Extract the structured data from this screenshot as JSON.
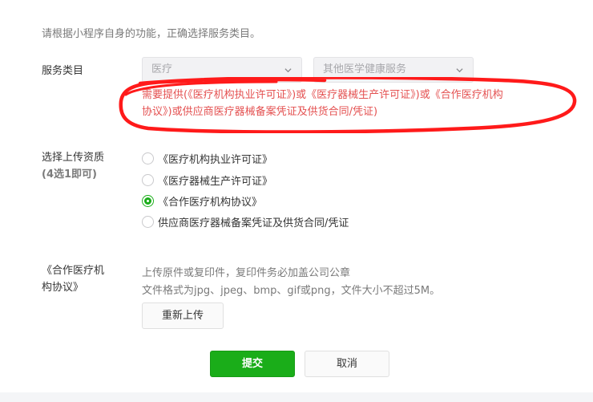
{
  "intro_text": "请根据小程序自身的功能，正确选择服务类目。",
  "category": {
    "label": "服务类目",
    "primary_value": "医疗",
    "secondary_value": "其他医学健康服务",
    "notice_line1": "需要提供(《医疗机构执业许可证》)或《医疗器械生产许可证》)或《合作医疗机构",
    "notice_line2": "协议》)或供应商医疗器械备案凭证及供货合同/凭证)"
  },
  "qualification": {
    "label": "选择上传资质",
    "sub_label": "(4选1即可)",
    "options": [
      {
        "label": "《医疗机构执业许可证》",
        "checked": false
      },
      {
        "label": "《医疗器械生产许可证》",
        "checked": false
      },
      {
        "label": "《合作医疗机构协议》",
        "checked": true
      },
      {
        "label": "供应商医疗器械备案凭证及供货合同/凭证",
        "checked": false
      }
    ]
  },
  "upload": {
    "label_line1": "《合作医疗机",
    "label_line2": "构协议》",
    "hint1": "上传原件或复印件，复印件务必加盖公司公章",
    "hint2": "文件格式为jpg、jpeg、bmp、gif或png，文件大小不超过5M。",
    "reupload_button": "重新上传"
  },
  "actions": {
    "submit": "提交",
    "cancel": "取消"
  },
  "colors": {
    "accent_green": "#1aad19",
    "notice_red": "#e45151",
    "annotation_red": "#ff1a1a"
  }
}
